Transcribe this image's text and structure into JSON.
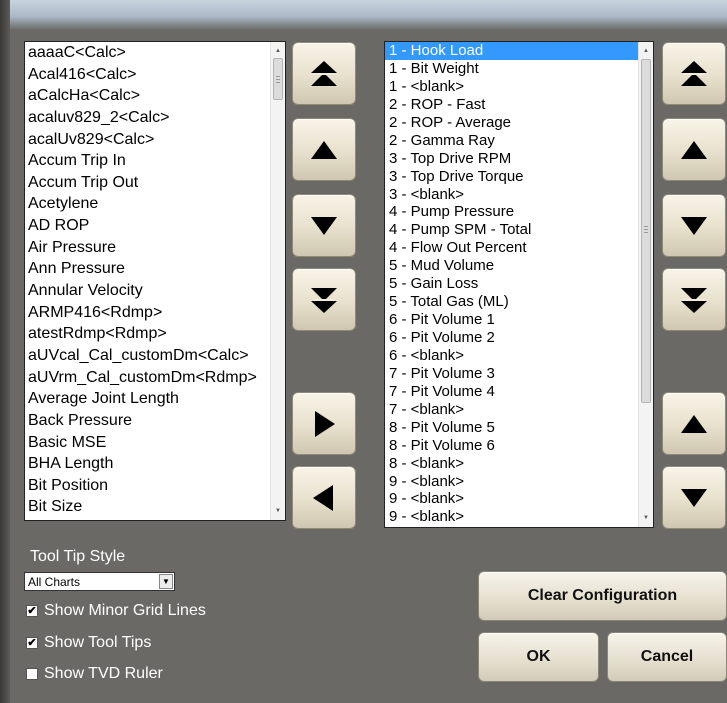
{
  "left_list": {
    "items": [
      "aaaaC<Calc>",
      "Acal416<Calc>",
      "aCalcHa<Calc>",
      "acaluv829_2<Calc>",
      "acalUv829<Calc>",
      "Accum Trip In",
      "Accum Trip Out",
      "Acetylene",
      "AD ROP",
      "Air Pressure",
      "Ann Pressure",
      "Annular Velocity",
      "ARMP416<Rdmp>",
      "atestRdmp<Rdmp>",
      "aUVcal_Cal_customDm<Calc>",
      "aUVrm_Cal_customDm<Rdmp>",
      "Average Joint Length",
      "Back Pressure",
      "Basic MSE",
      "BHA Length",
      "Bit Position",
      "Bit Size"
    ]
  },
  "right_list": {
    "selected_index": 0,
    "items": [
      "1 - Hook Load",
      "1 - Bit Weight",
      "1 - <blank>",
      "2 - ROP - Fast",
      "2 - ROP - Average",
      "2 - Gamma Ray",
      "3 - Top Drive RPM",
      "3 - Top Drive Torque",
      "3 - <blank>",
      "4 - Pump Pressure",
      "4 - Pump SPM - Total",
      "4 - Flow Out Percent",
      "5 - Mud Volume",
      "5 - Gain Loss",
      "5 - Total Gas (ML)",
      "6 - Pit Volume 1",
      "6 - Pit Volume 2",
      "6 - <blank>",
      "7 - Pit Volume 3",
      "7 - Pit Volume 4",
      "7 - <blank>",
      "8 - Pit Volume 5",
      "8 - Pit Volume 6",
      "8 - <blank>",
      "9 - <blank>",
      "9 - <blank>",
      "9 - <blank>"
    ]
  },
  "tool_tip": {
    "label": "Tool Tip Style",
    "selected": "All Charts"
  },
  "options": {
    "minor_grid": {
      "label": "Show Minor Grid Lines",
      "checked": true
    },
    "tool_tips": {
      "label": "Show Tool Tips",
      "checked": true
    },
    "tvd_ruler": {
      "label": "Show TVD Ruler",
      "checked": false
    }
  },
  "buttons": {
    "clear": "Clear Configuration",
    "ok": "OK",
    "cancel": "Cancel"
  },
  "icons": {
    "move_top": "double-up-arrow-icon",
    "move_up": "up-arrow-icon",
    "move_down": "down-arrow-icon",
    "move_bottom": "double-down-arrow-icon",
    "add": "right-arrow-icon",
    "remove": "left-arrow-icon"
  }
}
